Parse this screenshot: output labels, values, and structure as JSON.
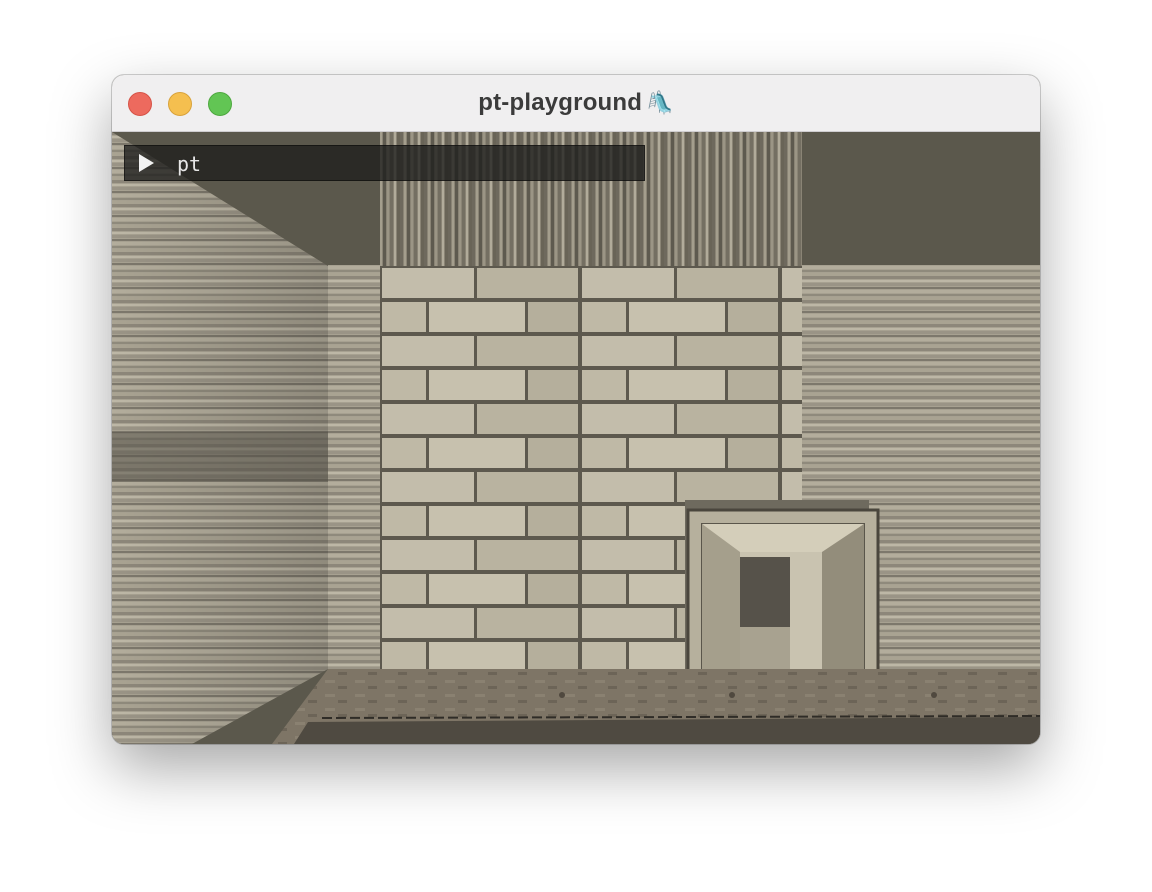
{
  "window": {
    "title": "pt-playground",
    "title_emoji": "🛝"
  },
  "command_bar": {
    "icon": "play-icon",
    "text": "pt"
  },
  "scene": {
    "description_colors": {
      "sky": "#5b584c",
      "stone": "#bcb6a4",
      "mortar": "#5a564b",
      "floor": "#7b7263"
    }
  }
}
